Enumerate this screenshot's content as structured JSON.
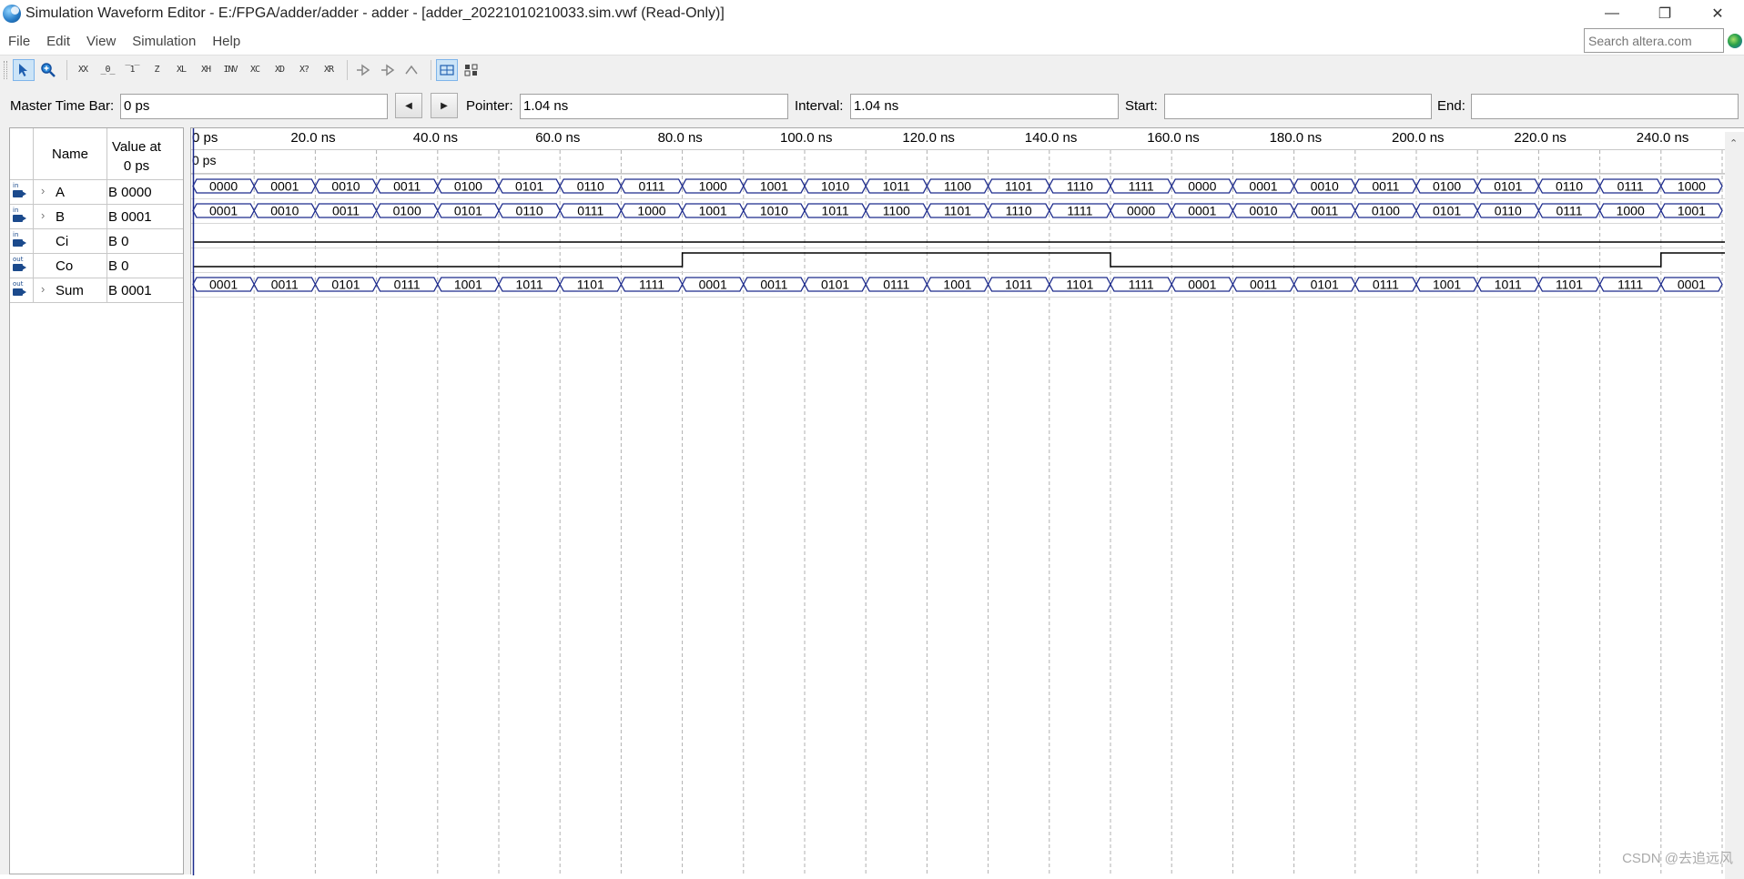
{
  "window": {
    "title": "Simulation Waveform Editor - E:/FPGA/adder/adder - adder - [adder_20221010210033.sim.vwf (Read-Only)]",
    "min": "—",
    "max": "❐",
    "close": "✕"
  },
  "menu": {
    "items": [
      "File",
      "Edit",
      "View",
      "Simulation",
      "Help"
    ],
    "search_placeholder": "Search altera.com"
  },
  "toolbar": {
    "tools": [
      "select-tool",
      "zoom-tool",
      "forcing-unknown",
      "forcing-low",
      "forcing-high",
      "high-impedance",
      "weak-low",
      "weak-high",
      "invert",
      "count-value",
      "forcing-clock",
      "random-value",
      "overwrite",
      "snap-to-grid",
      "sort"
    ]
  },
  "timebar": {
    "master_label": "Master Time Bar:",
    "master_value": "0 ps",
    "prev": "◀",
    "next": "▶",
    "pointer_label": "Pointer:",
    "pointer_value": "1.04 ns",
    "interval_label": "Interval:",
    "interval_value": "1.04 ns",
    "start_label": "Start:",
    "start_value": "",
    "end_label": "End:",
    "end_value": ""
  },
  "signals_header": {
    "name": "Name",
    "value_line1": "Value at",
    "value_line2": "0 ps"
  },
  "ruler": {
    "labels": [
      "0 ps",
      "20.0 ns",
      "40.0 ns",
      "60.0 ns",
      "80.0 ns",
      "100.0 ns",
      "120.0 ns",
      "140.0 ns",
      "160.0 ns",
      "180.0 ns",
      "200.0 ns",
      "220.0 ns",
      "240.0 ns"
    ],
    "pointer_label": "0 ps"
  },
  "signals": [
    {
      "name": "A",
      "dir": "in",
      "bus": true,
      "value": "B 0000",
      "bus_values": [
        "0000",
        "0001",
        "0010",
        "0011",
        "0100",
        "0101",
        "0110",
        "0111",
        "1000",
        "1001",
        "1010",
        "1011",
        "1100",
        "1101",
        "1110",
        "1111",
        "0000",
        "0001",
        "0010",
        "0011",
        "0100",
        "0101",
        "0110",
        "0111",
        "1000"
      ]
    },
    {
      "name": "B",
      "dir": "in",
      "bus": true,
      "value": "B 0001",
      "bus_values": [
        "0001",
        "0010",
        "0011",
        "0100",
        "0101",
        "0110",
        "0111",
        "1000",
        "1001",
        "1010",
        "1011",
        "1100",
        "1101",
        "1110",
        "1111",
        "0000",
        "0001",
        "0010",
        "0011",
        "0100",
        "0101",
        "0110",
        "0111",
        "1000",
        "1001"
      ]
    },
    {
      "name": "Ci",
      "dir": "in",
      "bus": false,
      "value": "B 0",
      "levels": [
        0
      ]
    },
    {
      "name": "Co",
      "dir": "out",
      "bus": false,
      "value": "B 0",
      "transitions_ns": [
        0,
        80,
        150,
        240
      ],
      "levels": [
        0,
        1,
        0,
        1
      ]
    },
    {
      "name": "Sum",
      "dir": "out",
      "bus": true,
      "value": "B 0001",
      "bus_values": [
        "0001",
        "0011",
        "0101",
        "0111",
        "1001",
        "1011",
        "1101",
        "1111",
        "0001",
        "0011",
        "0101",
        "0111",
        "1001",
        "1011",
        "1101",
        "1111",
        "0001",
        "0011",
        "0101",
        "0111",
        "1001",
        "1011",
        "1101",
        "1111",
        "0001"
      ]
    }
  ],
  "waveform": {
    "segment_ns": 10,
    "grid_ns": 10,
    "colors": {
      "bus": "#1c2a8c",
      "level": "#000000",
      "grid": "#b0b0b0",
      "cursor": "#1c2a8c"
    }
  },
  "watermark": "CSDN @去追远风"
}
